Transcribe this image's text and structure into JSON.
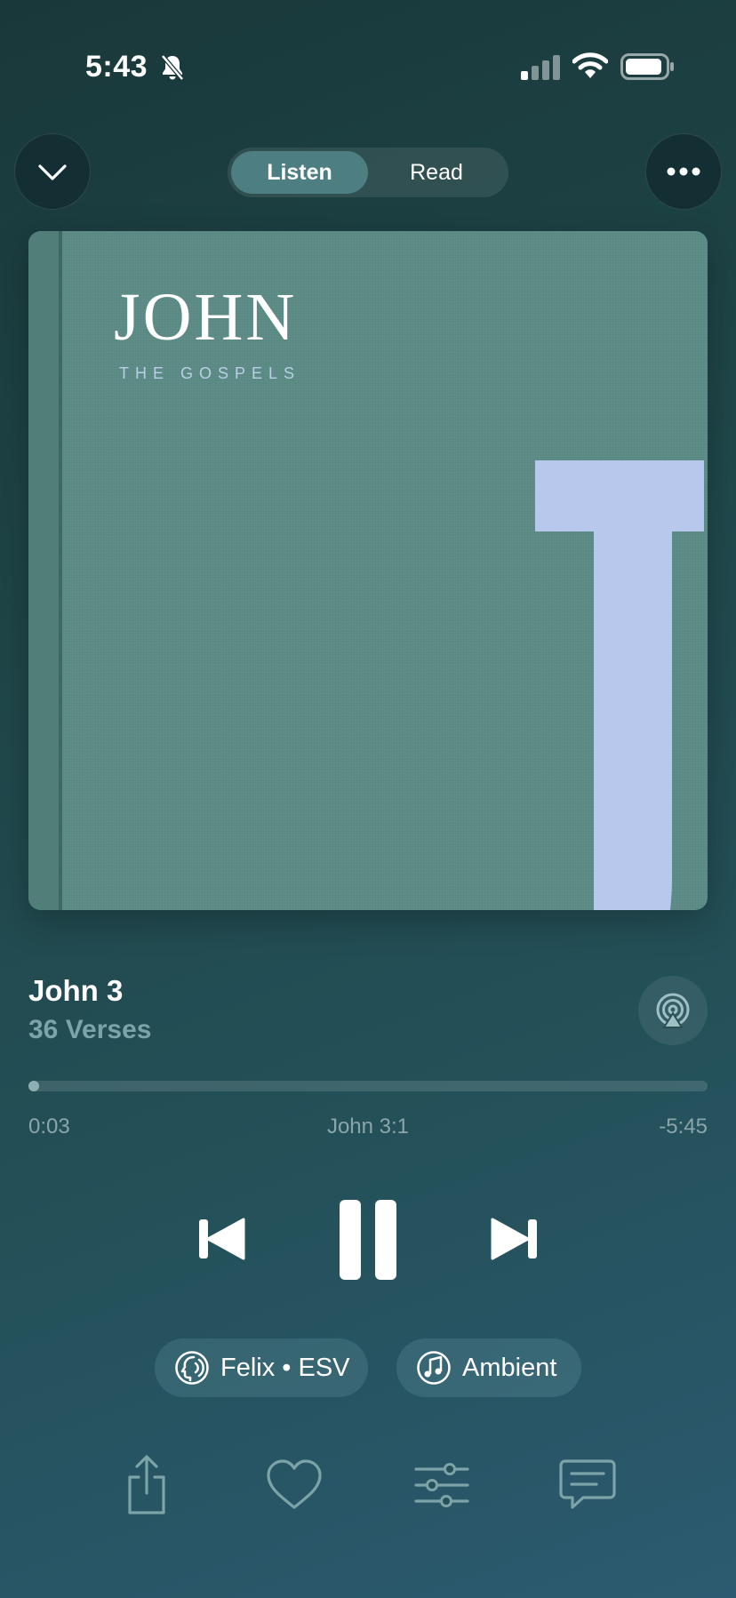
{
  "status_bar": {
    "time": "5:43"
  },
  "top": {
    "tabs": [
      "Listen",
      "Read"
    ],
    "active_tab": "Listen"
  },
  "cover": {
    "title": "JOHN",
    "subtitle": "THE GOSPELS",
    "letter": "J"
  },
  "track": {
    "title": "John 3",
    "subtitle": "36 Verses"
  },
  "progress": {
    "elapsed": "0:03",
    "reference": "John 3:1",
    "remaining": "-5:45",
    "fraction": 0.01
  },
  "options": {
    "voice": "Felix • ESV",
    "background": "Ambient"
  },
  "colors": {
    "background": "#1f4648",
    "accent": "#4d7f82",
    "cover": "#5c8b85",
    "cover_letter": "#b8c8ec",
    "muted_text": "#7ba3a8"
  },
  "icons": [
    "bell-slash-icon",
    "cellular-signal-icon",
    "wifi-icon",
    "battery-icon",
    "chevron-down-icon",
    "ellipsis-icon",
    "airplay-icon",
    "skip-back-icon",
    "pause-icon",
    "skip-forward-icon",
    "voice-icon",
    "music-note-icon",
    "share-icon",
    "heart-icon",
    "sliders-icon",
    "comment-icon"
  ]
}
